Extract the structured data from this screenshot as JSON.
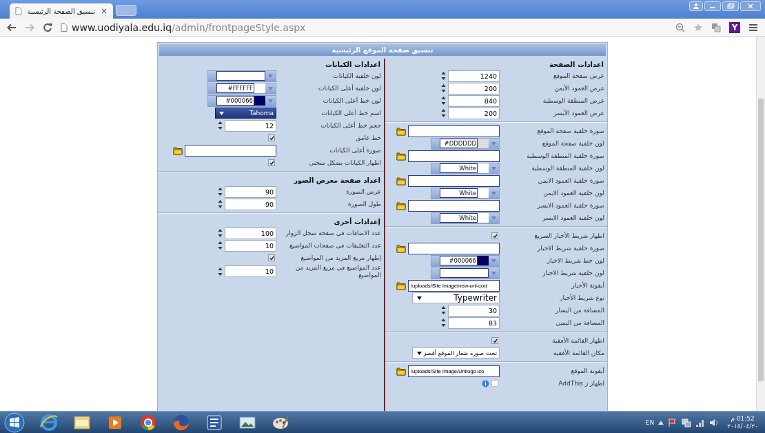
{
  "browser": {
    "tab_title": "تنسيق الصفحة الرئيسية",
    "tab_close": "×",
    "url_host": "www.uodiyala.edu.iq",
    "url_path": "/admin/frontpageStyle.aspx",
    "extension_badge": "Y"
  },
  "panel": {
    "title": "تنسيق صفحة الموقع الرئيسية",
    "columns": [
      {
        "sections": [
          {
            "heading": "اعدادات الصفحة",
            "rows": [
              {
                "kind": "spin",
                "label": "عرض صفحة الموقع",
                "value": "1240"
              },
              {
                "kind": "spin",
                "label": "عرض العمود الأيمن",
                "value": "200"
              },
              {
                "kind": "spin",
                "label": "عرض المنطقة الوسطية",
                "value": "840"
              },
              {
                "kind": "spin",
                "label": "عرض العمود الأيسر",
                "value": "200"
              }
            ]
          },
          {
            "rows": [
              {
                "kind": "image",
                "label": "صورة خلفية صفحة الموقع"
              },
              {
                "kind": "color",
                "label": "لون خلفية صفحة الموقع",
                "value": "#DDDDDD",
                "color": "#dddddd"
              },
              {
                "kind": "image",
                "label": "صورة خلفية المنطقة الوسطية"
              },
              {
                "kind": "color",
                "label": "لون خلفية المنطقة الوسطية",
                "value": "White",
                "color": "#ffffff"
              },
              {
                "kind": "image",
                "label": "صورة خلفية العمود الايمن"
              },
              {
                "kind": "color",
                "label": "لون خلفية العمود الايمن",
                "value": "White",
                "color": "#ffffff"
              },
              {
                "kind": "image",
                "label": "صورة خلفية العمود الايسر"
              },
              {
                "kind": "color",
                "label": "لون خلفية العمود الايسر",
                "value": "White",
                "color": "#ffffff"
              }
            ]
          },
          {
            "rows": [
              {
                "kind": "check",
                "label": "اظهار شريط الأخبار السريع",
                "checked": true
              },
              {
                "kind": "image",
                "label": "صورة خلفية شريط الاخبار"
              },
              {
                "kind": "color",
                "label": "لون خط شريط الاخبار",
                "value": "#000066",
                "color": "#000066"
              },
              {
                "kind": "color",
                "label": "لون خلفية شريط الاخبار"
              },
              {
                "kind": "image",
                "label": "أيقونة الأخبار",
                "value": "/uploads/Site Image/new-uni-cod"
              },
              {
                "kind": "select",
                "label": "نوع شريط الأخبار",
                "value": "Typewriter"
              },
              {
                "kind": "spin",
                "label": "المسافة من اليسار",
                "value": "30"
              },
              {
                "kind": "spin",
                "label": "المسافة من اليمين",
                "value": "83"
              }
            ]
          },
          {
            "rows": [
              {
                "kind": "check",
                "label": "اظهار القائمة الأفقية",
                "checked": true
              },
              {
                "kind": "select",
                "label": "مكان القائمة الأفقية",
                "value": "تحت صورة شعار الموقع أقصر"
              }
            ]
          },
          {
            "rows": [
              {
                "kind": "image",
                "label": "أيقونة الموقع",
                "value": "/uploads/Site Image/Unilogo.ico"
              },
              {
                "kind": "info-check",
                "label": "اظهار ز AddThis",
                "checked": false
              }
            ]
          }
        ]
      },
      {
        "sections": [
          {
            "heading": "اعدادات الكيانات",
            "rows": [
              {
                "kind": "color",
                "label": "لون خلفية الكيانات"
              },
              {
                "kind": "color",
                "label": "لون خلفية أعلى الكيانات",
                "value": "#FFFFFF",
                "color": "#ffffff"
              },
              {
                "kind": "color",
                "label": "لون خط أعلى الكيانات",
                "value": "#000066",
                "color": "#000066"
              },
              {
                "kind": "font",
                "label": "اسم خط أعلى الكيانات",
                "value": "Tahoma"
              },
              {
                "kind": "spin",
                "label": "حجم خط أعلى الكيانات",
                "value": "12"
              },
              {
                "kind": "check",
                "label": "خط غامق",
                "checked": true
              },
              {
                "kind": "image",
                "label": "صورة أعلى الكيانات"
              },
              {
                "kind": "check",
                "label": "اظهار الكيانات بشكل منحنى",
                "checked": true
              }
            ]
          },
          {
            "heading": "اعداد صفحة معرض الصور",
            "rows": [
              {
                "kind": "spin",
                "label": "عرض الصورة",
                "value": "90"
              },
              {
                "kind": "spin",
                "label": "طول الصورة",
                "value": "90"
              }
            ]
          },
          {
            "heading": "إعدادات أخرى",
            "rows": [
              {
                "kind": "spin",
                "label": "عدد الاضافات في صفحة سجل الزوار",
                "value": "100"
              },
              {
                "kind": "spin",
                "label": "عدد التعليقات في صفحات المواضيع",
                "value": "10"
              },
              {
                "kind": "check",
                "label": "إظهار مربع المزيد من المواضيع",
                "checked": true
              },
              {
                "kind": "spin",
                "label": "عدد المواضيع في مربع المزيد من المواضيع",
                "value": "10"
              }
            ]
          }
        ]
      }
    ]
  },
  "taskbar": {
    "language": "EN",
    "time": "01:52 م",
    "date": "٢٠١٥/٠٤/٢٠"
  }
}
